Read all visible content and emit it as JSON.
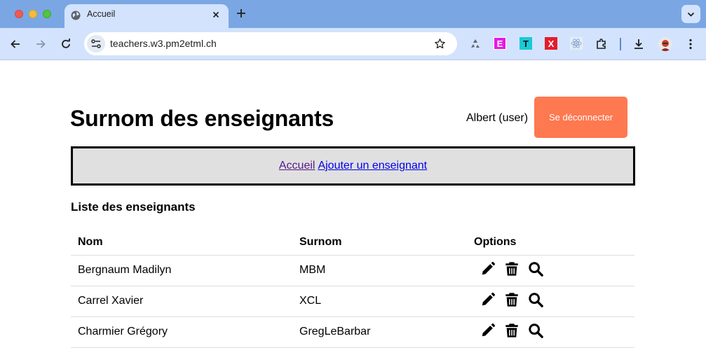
{
  "browser": {
    "tab": {
      "title": "Accueil"
    },
    "address_bar": {
      "url": "teachers.w3.pm2etml.ch"
    },
    "extensions": [
      {
        "label": "E",
        "icon": "extension-e-icon"
      },
      {
        "label": "T",
        "icon": "extension-t-icon"
      },
      {
        "label": "X",
        "icon": "extension-x-icon"
      },
      {
        "label": "",
        "icon": "react-devtools-icon"
      }
    ]
  },
  "header": {
    "title": "Surnom des enseignants",
    "user": "Albert (user)",
    "logout_label": "Se déconnecter"
  },
  "nav": {
    "links": [
      {
        "label": "Accueil",
        "visited": true
      },
      {
        "label": "Ajouter un enseignant",
        "visited": false
      }
    ]
  },
  "list": {
    "title": "Liste des enseignants",
    "columns": [
      "Nom",
      "Surnom",
      "Options"
    ],
    "rows": [
      {
        "nom": "Bergnaum Madilyn",
        "surnom": "MBM"
      },
      {
        "nom": "Carrel Xavier",
        "surnom": "XCL"
      },
      {
        "nom": "Charmier Grégory",
        "surnom": "GregLeBarbar"
      }
    ],
    "row_actions": [
      "pencil-icon",
      "trash-icon",
      "search-icon"
    ]
  },
  "colors": {
    "tabbar": "#7aa7e3",
    "toolbar": "#d3e3fd",
    "logout_button": "#fe7850",
    "nav_background": "#e0e0e0"
  }
}
